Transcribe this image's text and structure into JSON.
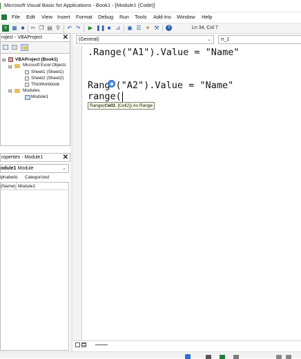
{
  "window": {
    "title": "Microsoft Visual Basic for Applications - Book1 - [Module1 (Code)]"
  },
  "menu": [
    "File",
    "Edit",
    "View",
    "Insert",
    "Format",
    "Debug",
    "Run",
    "Tools",
    "Add-Ins",
    "Window",
    "Help"
  ],
  "status": {
    "position": "Ln 34, Col 7"
  },
  "project_panel": {
    "title": "roject - VBAProject",
    "root": "VBAProject (Book1)",
    "folder_objects": "Microsoft Excel Objects",
    "sheet1": "Sheet1 (Sheet1)",
    "sheet2": "Sheet2 (Sheet2)",
    "workbook": "ThisWorkbook",
    "folder_modules": "Modules",
    "module1": "Module1"
  },
  "properties_panel": {
    "title": "roperties - Module1",
    "object_name": "odule1",
    "object_type": "Module",
    "tab_alphabetic": "lphabetic",
    "tab_categorized": "Categorized",
    "prop_name": "(Name)",
    "prop_value": "Module1"
  },
  "code_header": {
    "object_combo": "(General)",
    "proc_combo": "rr_1"
  },
  "code": {
    "line1": ".Range(\"A1\").Value = \"Name\"",
    "line2_before": "Rang",
    "line2_after": "(\"A2\").Value = \"Name\"",
    "line3": "range(",
    "tooltip_prefix": "Range(",
    "tooltip_arg1": "Cell1",
    "tooltip_mid": ", [Cell2]) As Range"
  },
  "colors": {
    "accent": "#2a5db0",
    "tooltip_bg": "#ffffe9",
    "autocomplete_icon": "#4a90e2"
  }
}
